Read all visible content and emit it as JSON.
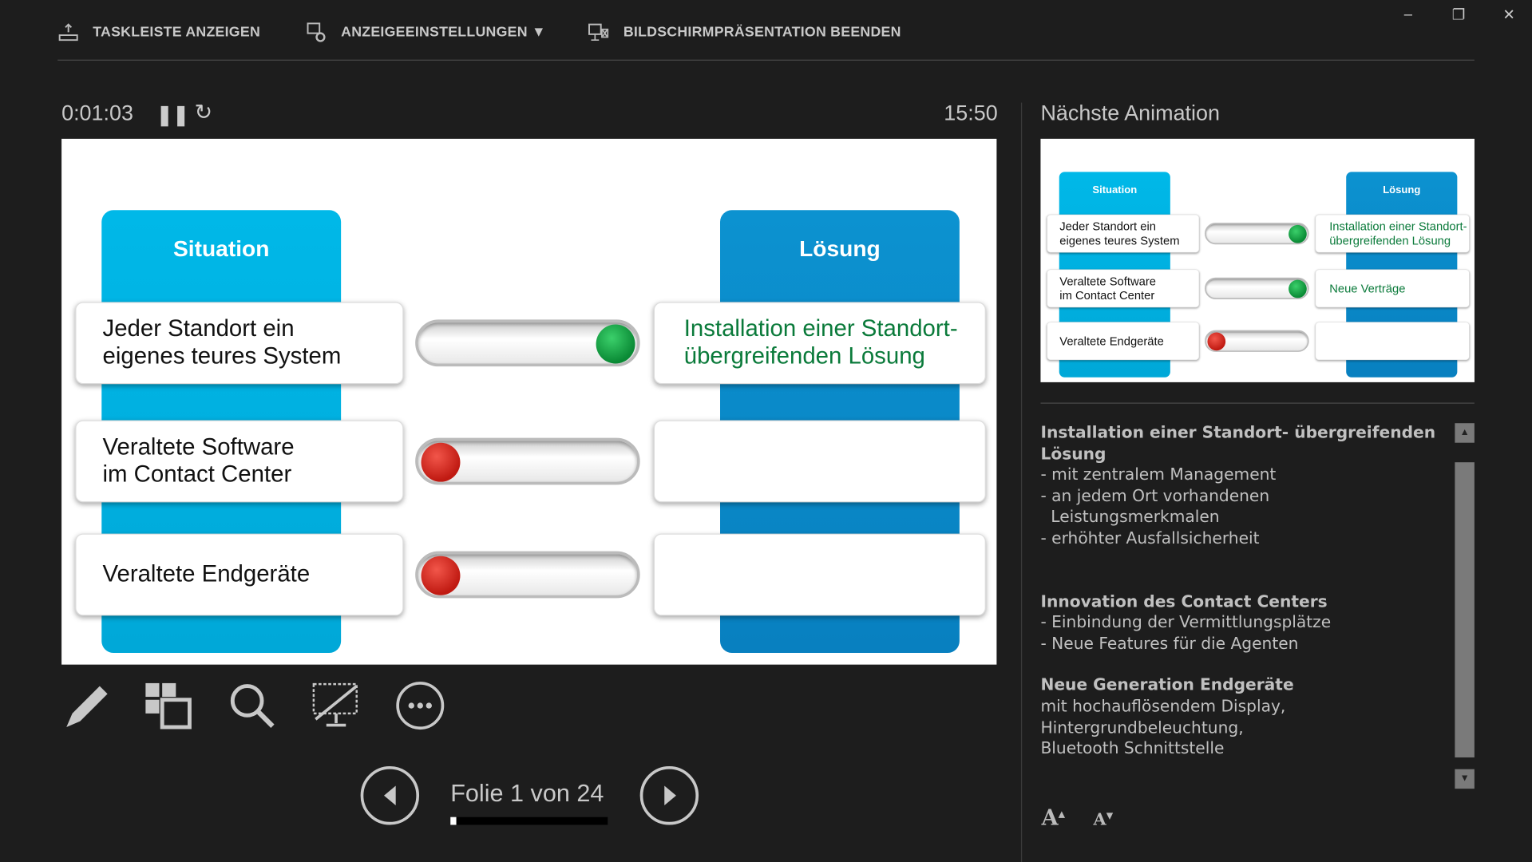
{
  "toolbar": {
    "taskbar": "TASKLEISTE ANZEIGEN",
    "display": "ANZEIGEEINSTELLUNGEN ▼",
    "end": "BILDSCHIRMPRÄSENTATION BEENDEN"
  },
  "window": {
    "minimize": "–",
    "restore": "❐",
    "close": "✕"
  },
  "timer": {
    "elapsed": "0:01:03",
    "clock": "15:50"
  },
  "next_panel": {
    "title": "Nächste Animation"
  },
  "slide": {
    "left_title": "Situation",
    "right_title": "Lösung",
    "rows": [
      {
        "left": "Jeder Standort ein\neigenes teures System",
        "right": "Installation einer Standort-\nübergreifenden Lösung",
        "toggle": "green"
      },
      {
        "left": "Veraltete Software\nim Contact Center",
        "right": "",
        "toggle": "red"
      },
      {
        "left": "Veraltete Endgeräte",
        "right": "",
        "toggle": "red"
      }
    ]
  },
  "thumb": {
    "left_title": "Situation",
    "right_title": "Lösung",
    "rows": [
      {
        "left": "Jeder Standort ein\neigenes teures System",
        "right": "Installation einer Standort-\nübergreifenden Lösung",
        "toggle": "green"
      },
      {
        "left": "Veraltete Software\nim Contact Center",
        "right": "Neue Verträge",
        "toggle": "green"
      },
      {
        "left": "Veraltete Endgeräte",
        "right": "",
        "toggle": "red"
      }
    ]
  },
  "navigation": {
    "slide_label": "Folie 1 von 24",
    "progress": 0.04
  },
  "notes": [
    {
      "title": "Installation einer Standort- übergreifenden Lösung",
      "lines": [
        "- mit zentralem Management",
        "- an jedem Ort vorhandenen",
        "  Leistungsmerkmalen",
        "- erhöhter Ausfallsicherheit"
      ]
    },
    {
      "title": "Innovation des Contact Centers",
      "lines": [
        "- Einbindung der Vermittlungsplätze",
        "- Neue Features für die Agenten"
      ]
    },
    {
      "title": "Neue Generation Endgeräte",
      "lines": [
        "mit hochauflösendem Display,",
        "Hintergrundbeleuchtung,",
        "Bluetooth Schnittstelle"
      ]
    }
  ],
  "colors": {
    "situation": "#00b3e3",
    "loesung": "#0b8bc9",
    "green_text": "#0a7a3a"
  }
}
